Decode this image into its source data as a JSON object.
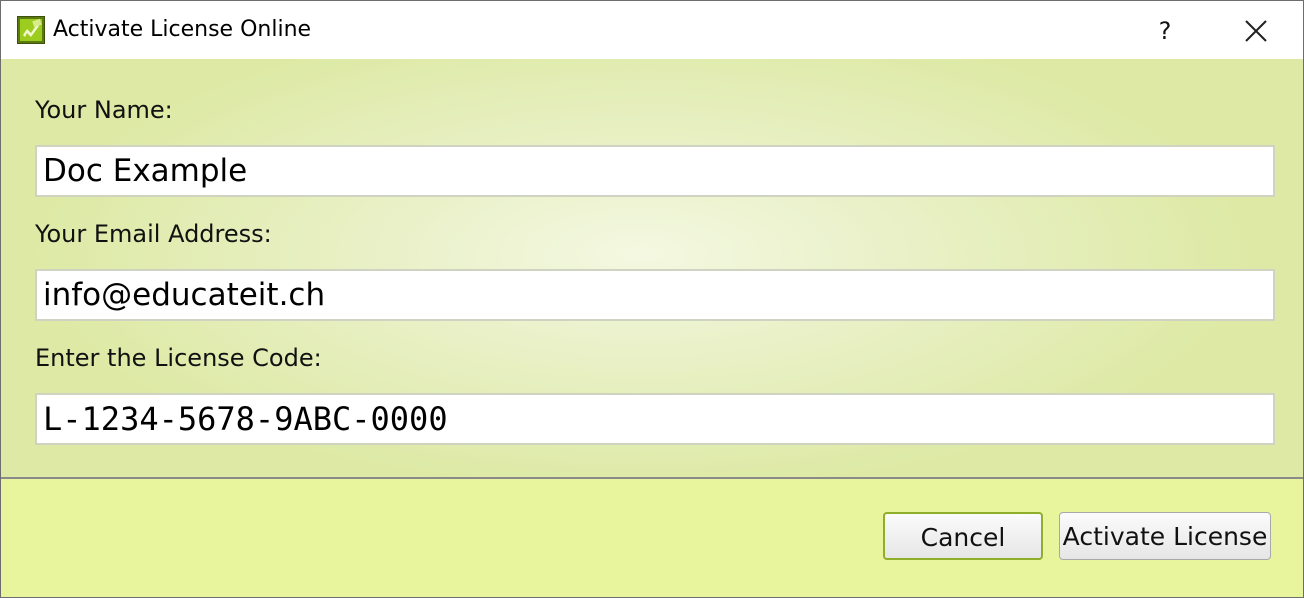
{
  "window": {
    "title": "Activate License Online",
    "help_label": "?",
    "icons": {
      "app": "license-app-icon",
      "close": "close-icon"
    }
  },
  "form": {
    "name_label": "Your Name:",
    "name_value": "Doc Example",
    "email_label": "Your Email Address:",
    "email_value": "info@educateit.ch",
    "code_label": "Enter the License Code:",
    "code_value": "L-1234-5678-9ABC-0000"
  },
  "buttons": {
    "cancel_label": "Cancel",
    "activate_label": "Activate License"
  },
  "colors": {
    "content_background": "#dde9a4",
    "footer_background": "#e8f59c",
    "cancel_border_accent": "#8fae2a"
  }
}
